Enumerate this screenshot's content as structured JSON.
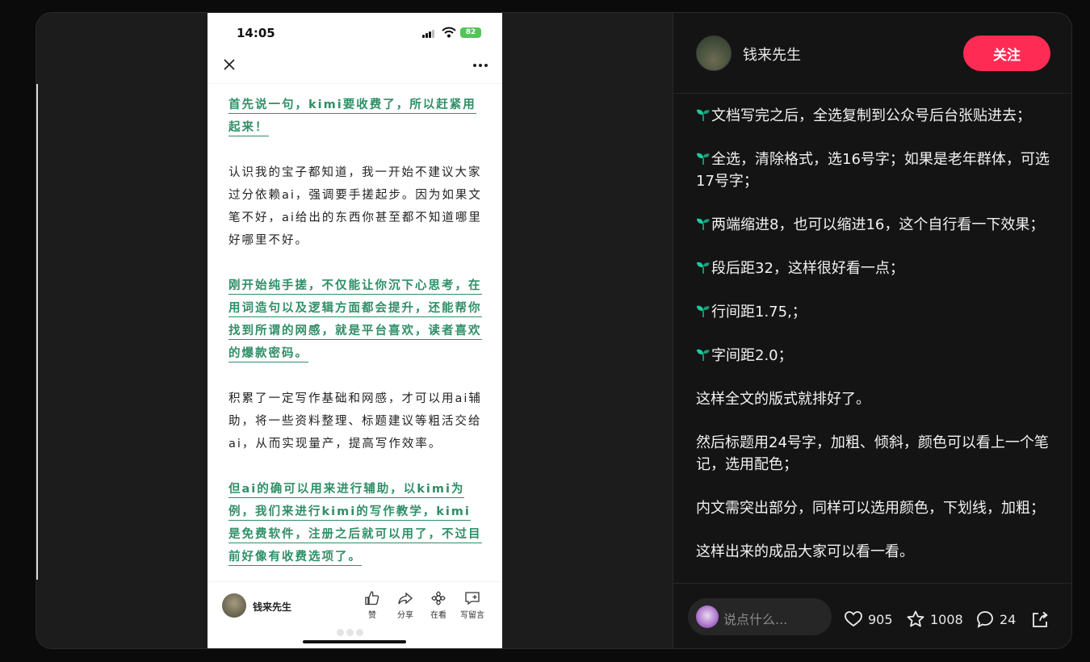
{
  "phone": {
    "time": "14:05",
    "battery": "82",
    "paragraphs": [
      {
        "text": "首先说一句，kimi要收费了，所以赶紧用起来！",
        "highlight": true
      },
      {
        "text": "认识我的宝子都知道，我一开始不建议大家过分依赖ai，强调要手搓起步。因为如果文笔不好，ai给出的东西你甚至都不知道哪里好哪里不好。",
        "highlight": false
      },
      {
        "text": "刚开始纯手搓，不仅能让你沉下心思考，在用词造句以及逻辑方面都会提升，还能帮你找到所谓的网感，就是平台喜欢，读者喜欢的爆款密码。",
        "highlight": true
      },
      {
        "text": "积累了一定写作基础和网感，才可以用ai辅助，将一些资料整理、标题建议等粗活交给ai，从而实现量产，提高写作效率。",
        "highlight": false
      },
      {
        "text": "但ai的确可以用来进行辅助，以kimi为例，我们来进行kimi的写作教学，kimi是免费软件，注册之后就可以用了，不过目前好像有收费选项了。",
        "highlight": true
      }
    ],
    "author": "钱来先生",
    "actions": [
      "赞",
      "分享",
      "在看",
      "写留言"
    ]
  },
  "panel": {
    "author": "钱来先生",
    "follow_label": "关注",
    "lines": [
      {
        "text": "文档写完之后，全选复制到公众号后台张贴进去；",
        "icon": "sprout-icon"
      },
      {
        "text": "全选，清除格式，选16号字；如果是老年群体，可选17号字；",
        "icon": "sprout-icon"
      },
      {
        "text": "两端缩进8，也可以缩进16，这个自行看一下效果；",
        "icon": "sprout-icon"
      },
      {
        "text": "段后距32，这样很好看一点；",
        "icon": "sprout-icon"
      },
      {
        "text": "行间距1.75,；",
        "icon": "sprout-icon"
      },
      {
        "text": "字间距2.0；",
        "icon": "sprout-icon"
      },
      {
        "text": "这样全文的版式就排好了。",
        "icon": null
      },
      {
        "text": "然后标题用24号字，加粗、倾斜，颜色可以看上一个笔记，选用配色；",
        "icon": null
      },
      {
        "text": "内文需突出部分，同样可以选用颜色，下划线，加粗；",
        "icon": null
      },
      {
        "text": "这样出来的成品大家可以看一看。",
        "icon": null
      }
    ],
    "comment_placeholder": "说点什么...",
    "likes": "905",
    "favorites": "1008",
    "comments": "24"
  },
  "colors": {
    "accent": "#fe2c55",
    "highlight_text": "#2f8f67",
    "sprout": "#1fc8a0"
  }
}
